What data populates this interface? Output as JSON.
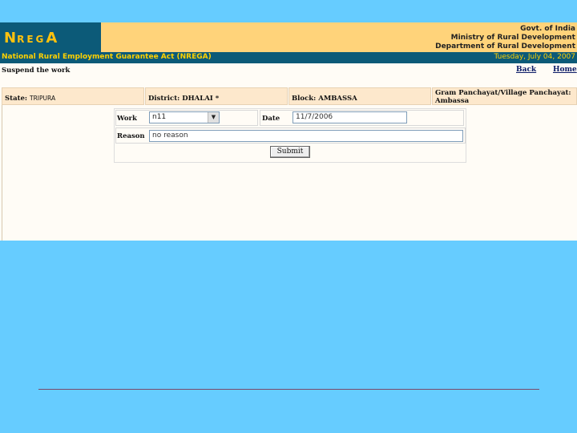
{
  "header": {
    "logo_n": "N",
    "logo_rega": "REG",
    "logo_a": "A",
    "gov_lines": [
      "Govt. of India",
      "Ministry of Rural Development",
      "Department of Rural Development"
    ],
    "act_title": "National Rural Employment Guarantee Act (NREGA)",
    "date": "Tuesday, July 04, 2007"
  },
  "nav": {
    "section_title": "Suspend the work",
    "back": "Back",
    "home": "Home"
  },
  "location": {
    "state_label": "State: ",
    "state_value": "TRIPURA",
    "district_label": "District: DHALAI *",
    "block_label": "Block: AMBASSA",
    "gp_label": "Gram Panchayat/Village Panchayat:",
    "gp_value": "Ambassa"
  },
  "form": {
    "work_label": "Work",
    "work_value": "n11",
    "date_label": "Date",
    "date_value": "11/7/2006",
    "reason_label": "Reason",
    "reason_value": "no reason",
    "submit_label": "Submit"
  },
  "colors": {
    "background": "#66ccff",
    "header_dark": "#0c5a78",
    "header_gold": "#ffd37a",
    "accent_yellow": "#ffd100",
    "cell_bg": "#fde8cc"
  }
}
